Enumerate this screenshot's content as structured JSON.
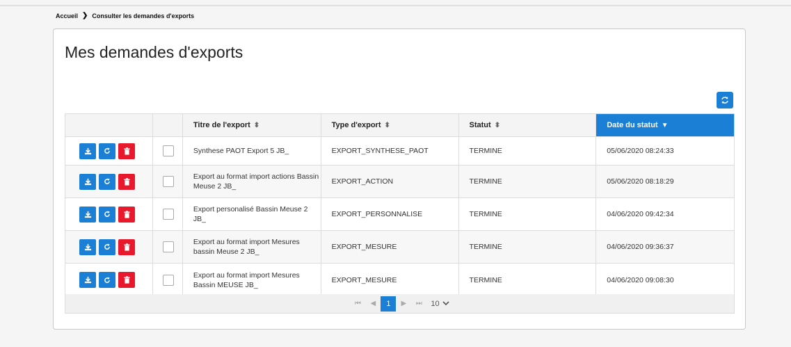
{
  "breadcrumb": {
    "home": "Accueil",
    "current": "Consulter les demandes d'exports"
  },
  "page": {
    "title": "Mes demandes d'exports"
  },
  "table": {
    "columns": [
      "Titre de l'export",
      "Type d'export",
      "Statut",
      "Date du statut"
    ],
    "sorted_column": "Date du statut",
    "rows": [
      {
        "title": "Synthese PAOT Export 5 JB_",
        "type": "EXPORT_SYNTHESE_PAOT",
        "status": "TERMINE",
        "date": "05/06/2020 08:24:33"
      },
      {
        "title": "Export au format import actions Bassin Meuse 2 JB_",
        "type": "EXPORT_ACTION",
        "status": "TERMINE",
        "date": "05/06/2020 08:18:29"
      },
      {
        "title": "Export personalisé Bassin Meuse 2 JB_",
        "type": "EXPORT_PERSONNALISE",
        "status": "TERMINE",
        "date": "04/06/2020 09:42:34"
      },
      {
        "title": "Export au format import Mesures bassin Meuse 2 JB_",
        "type": "EXPORT_MESURE",
        "status": "TERMINE",
        "date": "04/06/2020 09:36:37"
      },
      {
        "title": "Export au format import Mesures Bassin MEUSE JB_",
        "type": "EXPORT_MESURE",
        "status": "TERMINE",
        "date": "04/06/2020 09:08:30"
      }
    ]
  },
  "pagination": {
    "current_page": "1",
    "page_size": "10"
  },
  "icons": {
    "download": "download-icon",
    "refresh": "refresh-icon",
    "delete": "trash-icon"
  },
  "colors": {
    "primary": "#1c7fd6",
    "danger": "#e8192c"
  }
}
